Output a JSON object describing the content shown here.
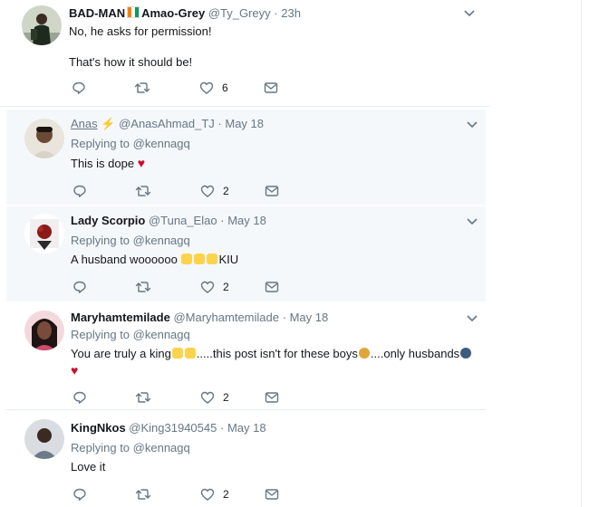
{
  "tweets": [
    {
      "name": "BAD-MAN",
      "name_suffix": "Amao-Grey",
      "handle": "@Ty_Greyy",
      "time": "23h",
      "lines": [
        "No, he asks for permission!",
        "That's how it should be!"
      ],
      "likes": "6"
    },
    {
      "name": "Anas",
      "handle": "@AnasAhmad_TJ",
      "time": "May 18",
      "replying_prefix": "Replying to",
      "replying_to": "@kennagq",
      "text": "This is dope",
      "likes": "2"
    },
    {
      "name": "Lady Scorpio",
      "handle": "@Tuna_Elao",
      "time": "May 18",
      "replying_prefix": "Replying to",
      "replying_to": "@kennagq",
      "text_before": "A husband woooooo",
      "text_after": "KIU",
      "likes": "2"
    },
    {
      "name": "Maryhamtemilade",
      "handle": "@Maryhamtemilade",
      "time": "May 18",
      "replying_prefix": "Replying to",
      "replying_to": "@kennagq",
      "text_a": "You are truly a king",
      "text_b": ".....this post isn't for these boys",
      "text_c": "....only husbands",
      "likes": "2"
    },
    {
      "name": "KingNkos",
      "handle": "@King31940545",
      "time": "May 18",
      "replying_prefix": "Replying to",
      "replying_to": "@kennagq",
      "text": "Love it",
      "likes": "2"
    }
  ],
  "separator": "·",
  "colors": {
    "secondary_text": "#657786",
    "divider": "#e6ecf0",
    "reply_bg": "#f5f8fa",
    "heart": "#c8102e"
  },
  "icons": [
    "reply-icon",
    "retweet-icon",
    "like-icon",
    "direct-message-icon",
    "chevron-down-icon"
  ]
}
